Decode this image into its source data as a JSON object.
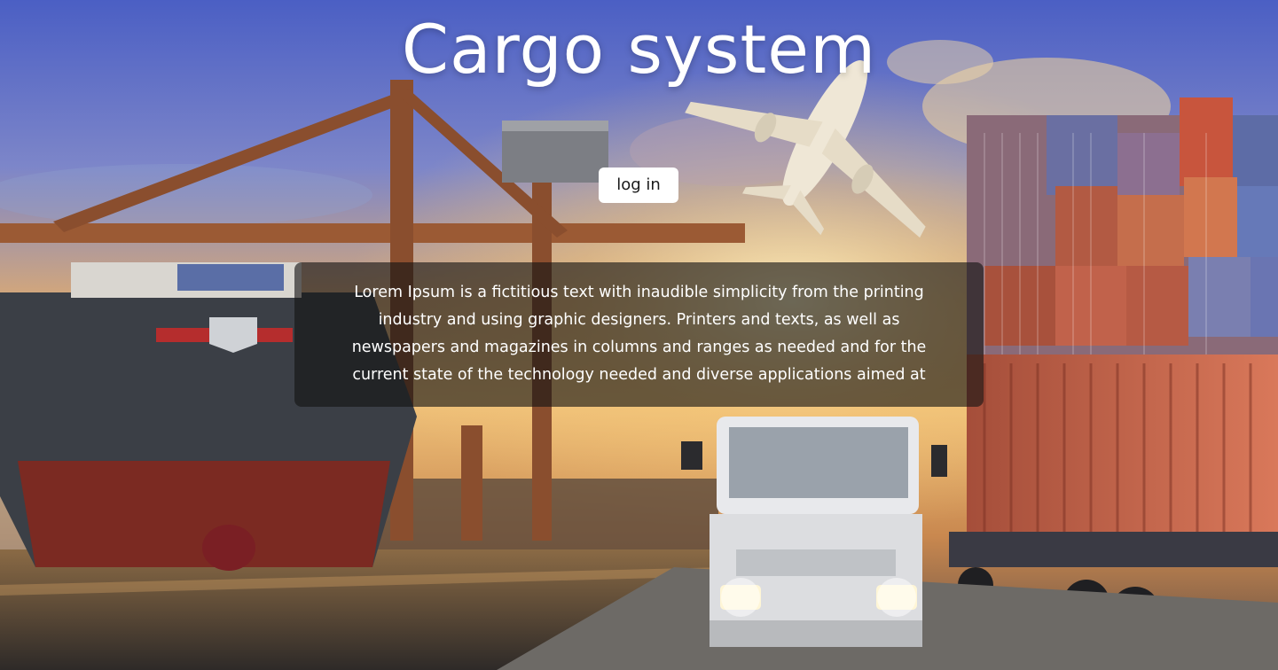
{
  "hero": {
    "title": "Cargo system",
    "login_label": "log in",
    "description": "Lorem Ipsum is a fictitious text with inaudible simplicity from the printing industry and using graphic designers. Printers and texts, as well as newspapers and magazines in columns and ranges as needed and for the current state of the technology needed and diverse applications aimed at"
  },
  "colors": {
    "title_text": "#ffffff",
    "button_bg": "#ffffff",
    "button_text": "#1a1a1a",
    "overlay_bg": "rgba(20,20,20,0.62)"
  },
  "icons": {
    "background": "cargo-logistics-scene-image"
  }
}
